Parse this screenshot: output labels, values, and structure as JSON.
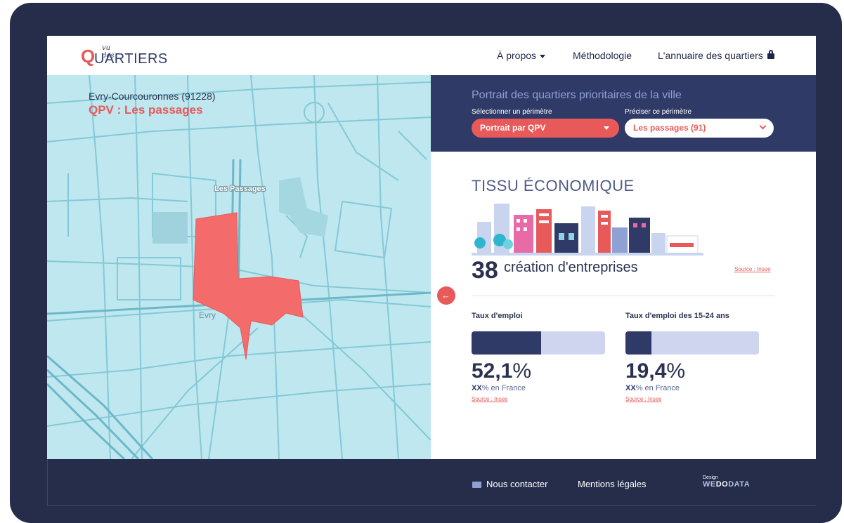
{
  "header": {
    "logo": {
      "small": "vu des",
      "initial": "Q",
      "rest": "UARTIERS"
    },
    "nav": [
      {
        "label": "À propos"
      },
      {
        "label": "Méthodologie"
      },
      {
        "label": "L'annuaire des quartiers"
      }
    ]
  },
  "map": {
    "city": "Evry-Courcouronnes (91228)",
    "qpv": "QPV : Les passages",
    "labels": {
      "passages": "Les Passages",
      "evry": "Evry"
    }
  },
  "panel": {
    "title": "Portrait des quartiers prioritaires de la ville",
    "select1": {
      "label": "Sélectionner un périmètre",
      "value": "Portrait par QPV"
    },
    "select2": {
      "label": "Préciser ce périmètre",
      "value": "Les passages (91)"
    }
  },
  "content": {
    "section_title": "TISSU ÉCONOMIQUE",
    "creation": {
      "number": "38",
      "text": "création d'entreprises",
      "source": "Source : Insee"
    },
    "metrics": [
      {
        "label": "Taux d'emploi",
        "value": "52,1",
        "pct": "%",
        "fraction": 0.521,
        "france_bold": "XX",
        "france_rest": "% en France",
        "source": "Source : Insee"
      },
      {
        "label": "Taux d'emploi des 15-24 ans",
        "value": "19,4",
        "pct": "%",
        "fraction": 0.194,
        "france_bold": "XX",
        "france_rest": "% en France",
        "source": "Source : Insee"
      }
    ]
  },
  "footer": {
    "contact": "Nous contacter",
    "mentions": "Mentions légales",
    "design_small": "Design",
    "design_brand_a": "WE",
    "design_brand_b": "DO",
    "design_brand_c": "DATA"
  },
  "colors": {
    "accent": "#e85a5a",
    "navy": "#2f3a67",
    "map": "#bfe7ef"
  }
}
